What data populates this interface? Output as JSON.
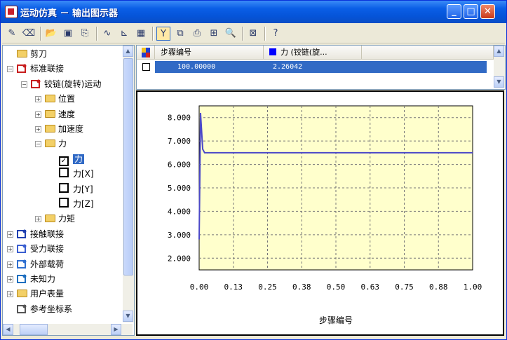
{
  "window": {
    "title": "运动仿真 － 输出图示器",
    "icon": "app-icon",
    "controls": {
      "minimize": "_",
      "maximize": "□",
      "close": "✕"
    }
  },
  "toolbar": {
    "icons": [
      "brush-icon",
      "eraser-icon",
      "open-icon",
      "save-icon",
      "export-icon",
      "curve-icon",
      "axis-icon",
      "color-chart-icon",
      "filter-icon",
      "copy-icon",
      "print-icon",
      "fit-icon",
      "zoom-icon",
      "excel-icon",
      "help-icon"
    ],
    "active": "filter-icon"
  },
  "tree": {
    "items": [
      {
        "label": "剪刀",
        "type": "folder",
        "level": 0,
        "expander": "none"
      },
      {
        "label": "标准联接",
        "type": "joint",
        "level": 0,
        "expander": "-"
      },
      {
        "label": "铰链(旋转)运动",
        "type": "joint",
        "level": 1,
        "expander": "-"
      },
      {
        "label": "位置",
        "type": "folder",
        "level": 2,
        "expander": "+"
      },
      {
        "label": "速度",
        "type": "folder",
        "level": 2,
        "expander": "+"
      },
      {
        "label": "加速度",
        "type": "folder",
        "level": 2,
        "expander": "+"
      },
      {
        "label": "力",
        "type": "folder",
        "level": 2,
        "expander": "-"
      },
      {
        "label": "力",
        "type": "check",
        "level": 3,
        "checked": true,
        "selected": true
      },
      {
        "label": "力[X]",
        "type": "check",
        "level": 3,
        "checked": false
      },
      {
        "label": "力[Y]",
        "type": "check",
        "level": 3,
        "checked": false
      },
      {
        "label": "力[Z]",
        "type": "check",
        "level": 3,
        "checked": false
      },
      {
        "label": "力矩",
        "type": "folder",
        "level": 2,
        "expander": "+"
      },
      {
        "label": "接触联接",
        "type": "contact",
        "level": 0,
        "expander": "+"
      },
      {
        "label": "受力联接",
        "type": "force",
        "level": 0,
        "expander": "+"
      },
      {
        "label": "外部载荷",
        "type": "load",
        "level": 0,
        "expander": "+"
      },
      {
        "label": "未知力",
        "type": "unknown",
        "level": 0,
        "expander": "+"
      },
      {
        "label": "用户表量",
        "type": "folder",
        "level": 0,
        "expander": "+"
      },
      {
        "label": "参考坐标系",
        "type": "axis",
        "level": 0,
        "expander": "none"
      }
    ]
  },
  "table": {
    "columns": [
      "步骤编号",
      "力 (铰链(旋..."
    ],
    "series_color": "#0000ff",
    "rows": [
      {
        "step": "100.00000",
        "value": "2.26042",
        "checked": false
      }
    ]
  },
  "chart_data": {
    "type": "line",
    "xlabel": "步骤编号",
    "ylabel": "",
    "xlim": [
      0,
      1
    ],
    "ylim": [
      1.5,
      8.5
    ],
    "x_ticks": [
      "0.00",
      "0.13",
      "0.25",
      "0.38",
      "0.50",
      "0.63",
      "0.75",
      "0.88",
      "1.00"
    ],
    "y_ticks": [
      "2.000",
      "3.000",
      "4.000",
      "5.000",
      "6.000",
      "7.000",
      "8.000"
    ],
    "grid": true,
    "background": "#ffffcc",
    "series": [
      {
        "color": "#4b48c8",
        "x": [
          0.0,
          0.005,
          0.013,
          0.02,
          1.0
        ],
        "y": [
          2.8,
          8.2,
          6.65,
          6.5,
          6.5
        ]
      }
    ]
  }
}
